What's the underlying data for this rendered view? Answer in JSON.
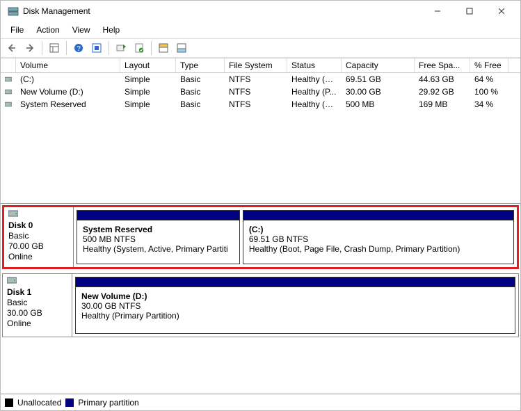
{
  "window": {
    "title": "Disk Management"
  },
  "menu": {
    "file": "File",
    "action": "Action",
    "view": "View",
    "help": "Help"
  },
  "columns": {
    "volume": "Volume",
    "layout": "Layout",
    "type": "Type",
    "filesystem": "File System",
    "status": "Status",
    "capacity": "Capacity",
    "freespace": "Free Spa...",
    "pctfree": "% Free"
  },
  "volumes": [
    {
      "name": "(C:)",
      "layout": "Simple",
      "type": "Basic",
      "fs": "NTFS",
      "status": "Healthy (B...",
      "capacity": "69.51 GB",
      "free": "44.63 GB",
      "pct": "64 %"
    },
    {
      "name": "New Volume (D:)",
      "layout": "Simple",
      "type": "Basic",
      "fs": "NTFS",
      "status": "Healthy (P...",
      "capacity": "30.00 GB",
      "free": "29.92 GB",
      "pct": "100 %"
    },
    {
      "name": "System Reserved",
      "layout": "Simple",
      "type": "Basic",
      "fs": "NTFS",
      "status": "Healthy (S...",
      "capacity": "500 MB",
      "free": "169 MB",
      "pct": "34 %"
    }
  ],
  "disks": [
    {
      "name": "Disk 0",
      "type": "Basic",
      "size": "70.00 GB",
      "state": "Online",
      "highlight": true,
      "parts": [
        {
          "title": "System Reserved",
          "sub": "500 MB NTFS",
          "status": "Healthy (System, Active, Primary Partiti",
          "flex": 3
        },
        {
          "title": "(C:)",
          "sub": "69.51 GB NTFS",
          "status": "Healthy (Boot, Page File, Crash Dump, Primary Partition)",
          "flex": 5
        }
      ]
    },
    {
      "name": "Disk 1",
      "type": "Basic",
      "size": "30.00 GB",
      "state": "Online",
      "highlight": false,
      "parts": [
        {
          "title": "New Volume  (D:)",
          "sub": "30.00 GB NTFS",
          "status": "Healthy (Primary Partition)",
          "flex": 1
        }
      ]
    }
  ],
  "legend": {
    "unallocated": "Unallocated",
    "primary": "Primary partition"
  }
}
